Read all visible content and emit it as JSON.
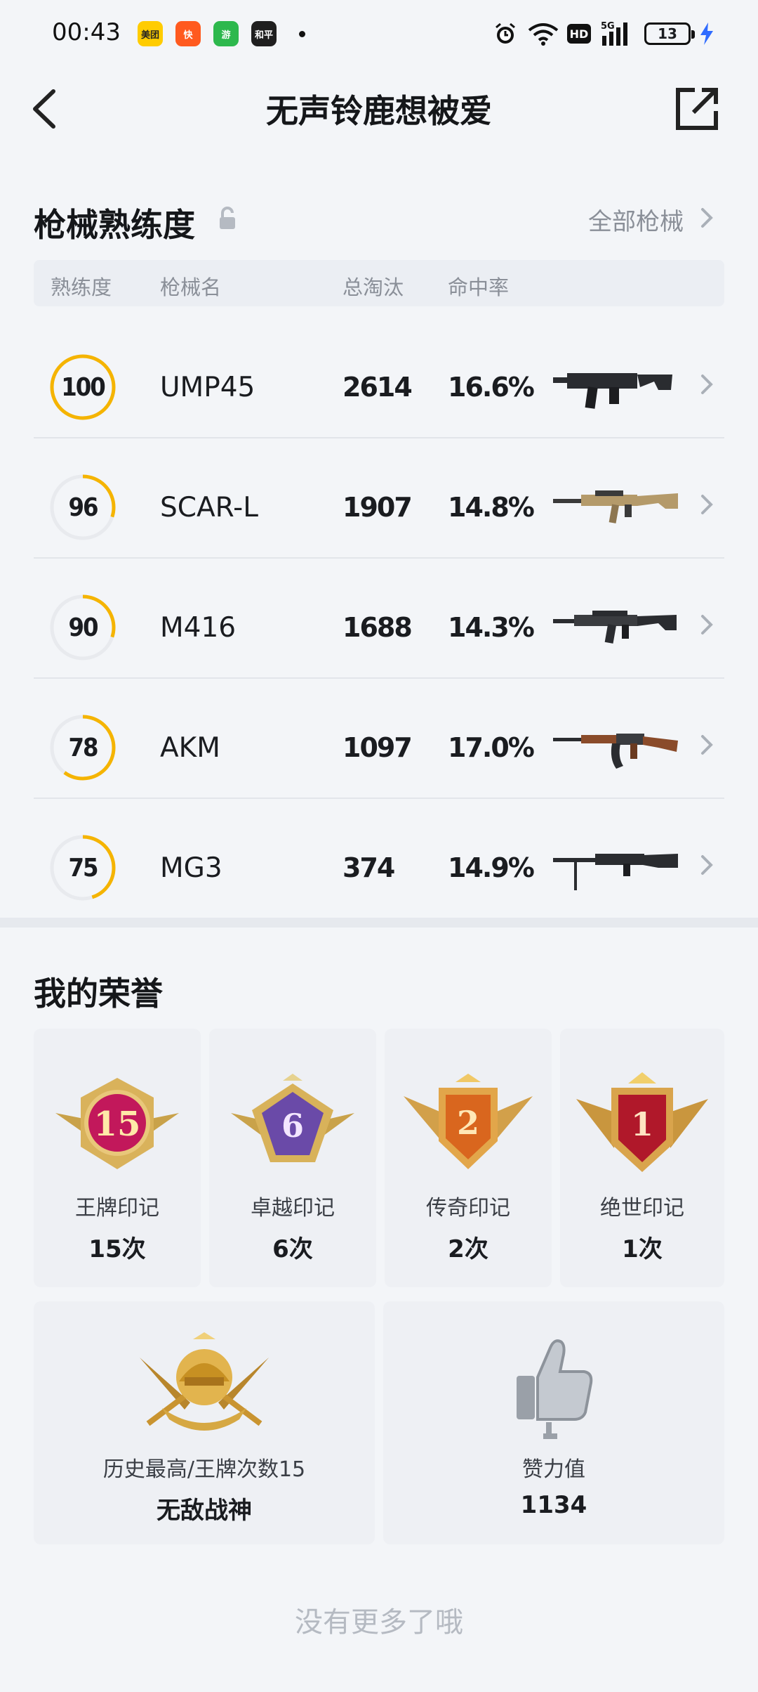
{
  "status": {
    "time": "00:43",
    "apps": [
      {
        "name": "meituan-app-icon",
        "text": "美团",
        "color": "#ffcc00",
        "textColor": "#222"
      },
      {
        "name": "kuaishou-app-icon",
        "text": "快",
        "color": "#ff5a1f",
        "textColor": "#fff"
      },
      {
        "name": "game-app-icon",
        "text": "游",
        "color": "#2db84d",
        "textColor": "#fff"
      },
      {
        "name": "heping-app-icon",
        "text": "和平",
        "color": "#1f1f1f",
        "textColor": "#fff"
      }
    ],
    "hd": "HD",
    "network": "5G",
    "battery": "13"
  },
  "header": {
    "title": "无声铃鹿想被爱"
  },
  "weapons": {
    "title": "枪械熟练度",
    "all_link": "全部枪械",
    "columns": [
      "熟练度",
      "枪械名",
      "总淘汰",
      "命中率"
    ],
    "rows": [
      {
        "level": "100",
        "progress": 1.0,
        "name": "UMP45",
        "kills": "2614",
        "accuracy": "16.6%",
        "gun": "smg"
      },
      {
        "level": "96",
        "progress": 0.3,
        "name": "SCAR-L",
        "kills": "1907",
        "accuracy": "14.8%",
        "gun": "rifle-tan"
      },
      {
        "level": "90",
        "progress": 0.3,
        "name": "M416",
        "kills": "1688",
        "accuracy": "14.3%",
        "gun": "rifle"
      },
      {
        "level": "78",
        "progress": 0.6,
        "name": "AKM",
        "kills": "1097",
        "accuracy": "17.0%",
        "gun": "ak"
      },
      {
        "level": "75",
        "progress": 0.45,
        "name": "MG3",
        "kills": "374",
        "accuracy": "14.9%",
        "gun": "mg"
      }
    ]
  },
  "honors": {
    "title": "我的荣誉",
    "badges": [
      {
        "label": "王牌印记",
        "value": "15次",
        "num": "15",
        "color": "#c2185b"
      },
      {
        "label": "卓越印记",
        "value": "6次",
        "num": "6",
        "color": "#6a4aa8"
      },
      {
        "label": "传奇印记",
        "value": "2次",
        "num": "2",
        "color": "#d9661e"
      },
      {
        "label": "绝世印记",
        "value": "1次",
        "num": "1",
        "color": "#b0182a"
      }
    ],
    "best": {
      "label": "历史最高/王牌次数15",
      "value": "无敌战神"
    },
    "likes": {
      "label": "赞力值",
      "value": "1134"
    }
  },
  "footer": "没有更多了哦",
  "colors": {
    "accent": "#f5b400",
    "ring_bg": "#e8eaee"
  }
}
